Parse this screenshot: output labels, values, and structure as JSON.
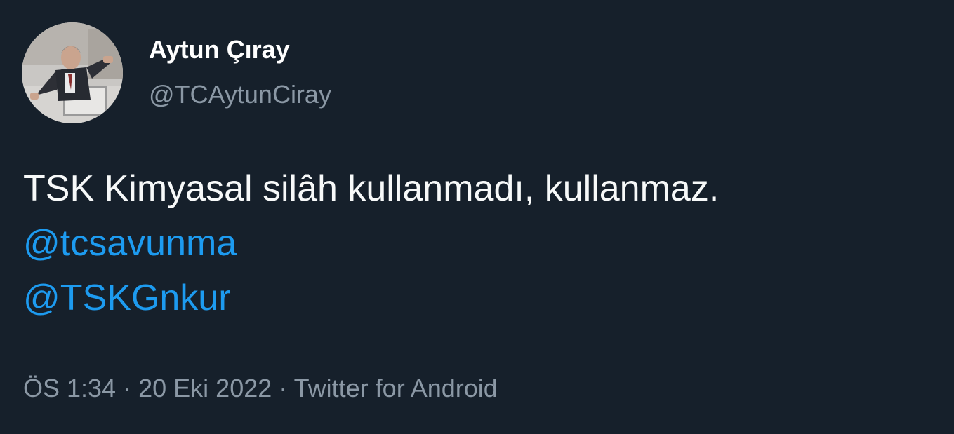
{
  "author": {
    "display_name": "Aytun Çıray",
    "handle": "@TCAytunCiray",
    "avatar_icon": "profile-photo-speaker-at-podium"
  },
  "tweet": {
    "text": "TSK Kimyasal silâh kullanmadı, kullanmaz.",
    "mentions": [
      "@tcsavunma",
      "@TSKGnkur"
    ]
  },
  "meta": {
    "time": "ÖS 1:34",
    "separator": "·",
    "date": "20 Eki 2022",
    "source": "Twitter for Android"
  },
  "colors": {
    "background": "#16202b",
    "text": "#f7f9f9",
    "secondary_text": "#8b98a5",
    "link": "#1d9bf0"
  }
}
